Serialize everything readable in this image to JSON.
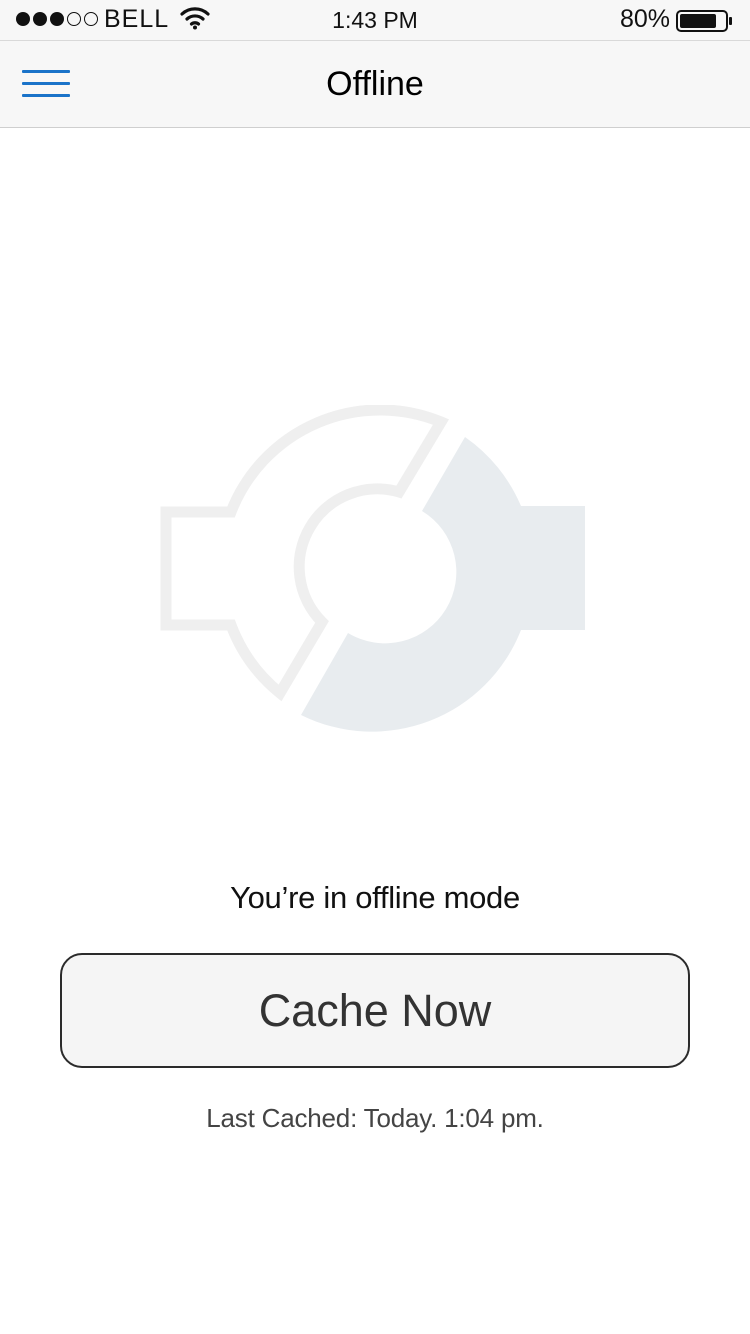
{
  "status_bar": {
    "signal_bars_filled": 3,
    "signal_bars_total": 5,
    "carrier": "BELL",
    "time": "1:43 PM",
    "battery_percent": "80%",
    "battery_level": 0.8
  },
  "header": {
    "title": "Offline",
    "menu_icon": "hamburger-menu-icon",
    "accent_color": "#1a73c9"
  },
  "main": {
    "illustration_icon": "offline-sync-icon",
    "message": "You’re in offline mode",
    "cache_button_label": "Cache Now",
    "last_cached": "Last Cached: Today. 1:04 pm."
  }
}
